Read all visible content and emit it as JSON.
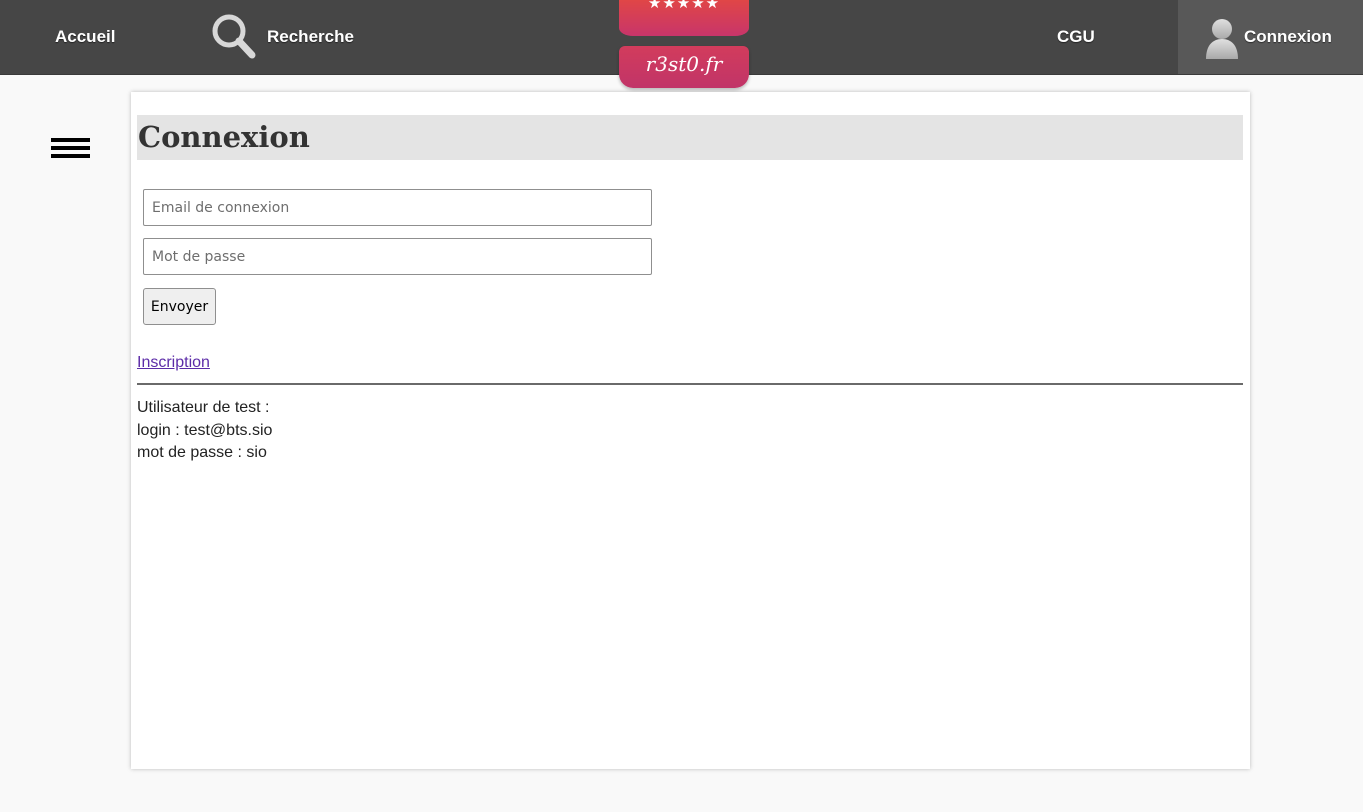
{
  "header": {
    "nav": {
      "accueil": "Accueil",
      "recherche": "Recherche",
      "cgu": "CGU",
      "connexion": "Connexion"
    },
    "logo": {
      "stars": "★★★★★",
      "text": "r3st0.fr"
    },
    "icons": {
      "search": "search-icon",
      "user": "user-icon"
    },
    "colors": {
      "bar": "#464646",
      "active_tab": "#585858",
      "logo_red": "#e04646",
      "logo_magenta": "#c13468"
    }
  },
  "sidebar": {
    "menu_icon": "hamburger-menu-icon"
  },
  "main": {
    "title": "Connexion",
    "form": {
      "email": {
        "placeholder": "Email de connexion",
        "value": ""
      },
      "password": {
        "placeholder": "Mot de passe",
        "value": ""
      },
      "submit_label": "Envoyer"
    },
    "inscription_label": "Inscription",
    "test_info": {
      "line1": "Utilisateur de test :",
      "line2": "login : test@bts.sio",
      "line3": "mot de passe : sio"
    }
  }
}
